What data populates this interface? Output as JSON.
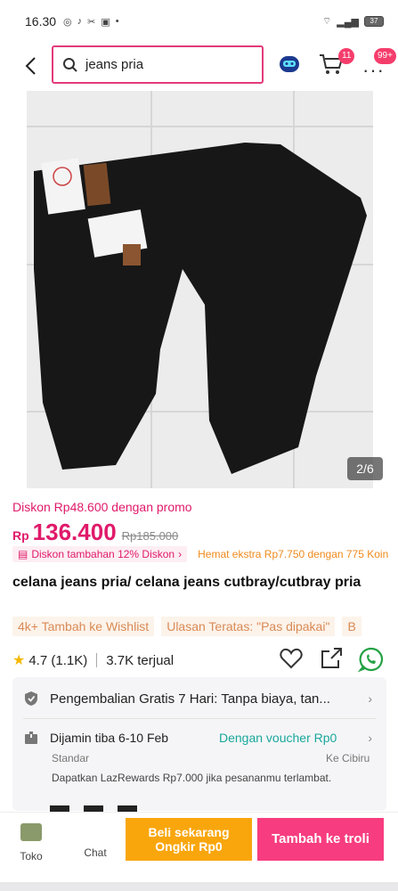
{
  "status_bar": {
    "time": "16.30",
    "battery": "37",
    "icons": [
      "instagram-icon",
      "tiktok-icon",
      "capcut-icon",
      "shopping-bag-icon",
      "dot-icon"
    ],
    "right_icons": [
      "wifi-icon",
      "signal-icon",
      "battery-icon"
    ]
  },
  "header": {
    "search_query": "jeans pria",
    "cart_badge": "11",
    "more_badge": "99+",
    "accent_color": "#e33a7a"
  },
  "gallery": {
    "counter": "2/6"
  },
  "price": {
    "promo_text": "Diskon Rp48.600 dengan promo",
    "currency": "Rp",
    "value": "136.400",
    "original": "Rp185.000",
    "extra_discount": "Diskon tambahan 12% Diskon",
    "extra_saving": "Hemat ekstra Rp7.750 dengan 775 Koin",
    "price_color": "#e01a6a"
  },
  "product": {
    "title": "celana jeans pria/ celana jeans cutbray/cutbray pria",
    "wishlist": "4k+ Tambah ke Wishlist",
    "top_review": "Ulasan Teratas: \"Pas dipakai\"",
    "rating": "4.7 (1.1K)",
    "sold": "3.7K terjual"
  },
  "info": {
    "return_policy": "Pengembalian Gratis 7 Hari: Tanpa biaya, tan...",
    "delivery_date": "Dijamin tiba 6-10 Feb",
    "voucher": "Dengan voucher Rp0",
    "shipping_type": "Standar",
    "courier": "Ke Cibiru",
    "lazrewards": "Dapatkan LazRewards Rp7.000 jika pesananmu terlambat."
  },
  "bottom": {
    "toko": "Toko",
    "chat": "Chat",
    "buy_line1": "Beli sekarang",
    "buy_line2": "Ongkir Rp0",
    "add_to_cart": "Tambah ke troli",
    "buy_color": "#f9a60d",
    "cart_color": "#f73d7f"
  }
}
